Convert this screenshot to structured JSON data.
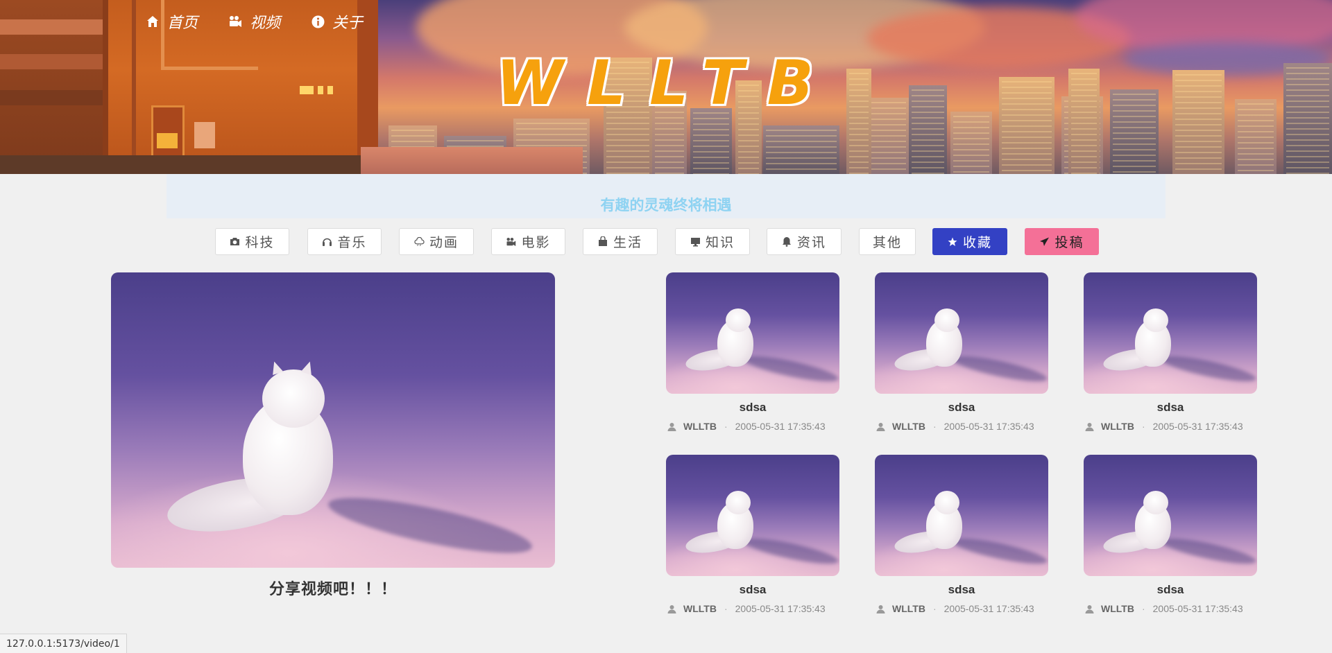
{
  "nav": {
    "items": [
      {
        "label": "首页",
        "icon": "home-icon"
      },
      {
        "label": "视频",
        "icon": "video-camera-icon"
      },
      {
        "label": "关于",
        "icon": "info-icon"
      }
    ]
  },
  "brand": {
    "logo_text": "WLLTB"
  },
  "slogan": "有趣的灵魂终将相遇",
  "categories": [
    {
      "label": "科技",
      "icon": "camera-icon"
    },
    {
      "label": "音乐",
      "icon": "headphones-icon"
    },
    {
      "label": "动画",
      "icon": "cloud-icon"
    },
    {
      "label": "电影",
      "icon": "video-camera-icon"
    },
    {
      "label": "生活",
      "icon": "shopping-bag-icon"
    },
    {
      "label": "知识",
      "icon": "monitor-icon"
    },
    {
      "label": "资讯",
      "icon": "bell-icon"
    },
    {
      "label": "其他",
      "icon": ""
    },
    {
      "label": "收藏",
      "icon": "star-icon",
      "color": "#3341c4"
    },
    {
      "label": "投稿",
      "icon": "paper-plane-icon",
      "color": "#f47097"
    }
  ],
  "featured": {
    "title": "分享视频吧！！！"
  },
  "videos": [
    {
      "title": "sdsa",
      "author": "WLLTB",
      "date": "2005-05-31 17:35:43"
    },
    {
      "title": "sdsa",
      "author": "WLLTB",
      "date": "2005-05-31 17:35:43"
    },
    {
      "title": "sdsa",
      "author": "WLLTB",
      "date": "2005-05-31 17:35:43"
    },
    {
      "title": "sdsa",
      "author": "WLLTB",
      "date": "2005-05-31 17:35:43"
    },
    {
      "title": "sdsa",
      "author": "WLLTB",
      "date": "2005-05-31 17:35:43"
    },
    {
      "title": "sdsa",
      "author": "WLLTB",
      "date": "2005-05-31 17:35:43"
    }
  ],
  "status_url": "127.0.0.1:5173/video/1"
}
